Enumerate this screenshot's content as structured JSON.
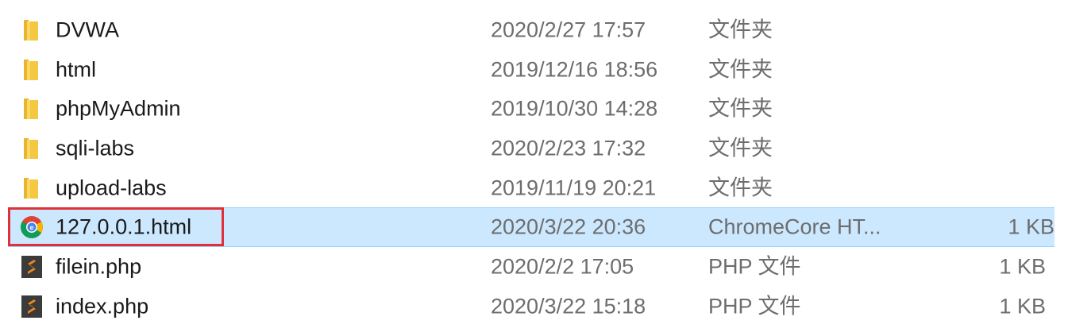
{
  "files": [
    {
      "name": "DVWA",
      "date": "2020/2/27 17:57",
      "type": "文件夹",
      "size": "",
      "icon": "folder-icon"
    },
    {
      "name": "html",
      "date": "2019/12/16 18:56",
      "type": "文件夹",
      "size": "",
      "icon": "folder-icon"
    },
    {
      "name": "phpMyAdmin",
      "date": "2019/10/30 14:28",
      "type": "文件夹",
      "size": "",
      "icon": "folder-icon"
    },
    {
      "name": "sqli-labs",
      "date": "2020/2/23 17:32",
      "type": "文件夹",
      "size": "",
      "icon": "folder-icon"
    },
    {
      "name": "upload-labs",
      "date": "2019/11/19 20:21",
      "type": "文件夹",
      "size": "",
      "icon": "folder-icon"
    },
    {
      "name": "127.0.0.1.html",
      "date": "2020/3/22 20:36",
      "type": "ChromeCore HT...",
      "size": "1 KB",
      "icon": "chrome-html-icon",
      "selected": true
    },
    {
      "name": "filein.php",
      "date": "2020/2/2 17:05",
      "type": "PHP 文件",
      "size": "1 KB",
      "icon": "php-file-icon"
    },
    {
      "name": "index.php",
      "date": "2020/3/22 15:18",
      "type": "PHP 文件",
      "size": "1 KB",
      "icon": "php-file-icon"
    }
  ],
  "colors": {
    "selection_bg": "#cce8ff",
    "selection_border": "#99d1ff",
    "highlight_box": "#e0303a",
    "folder": "#f0c038",
    "php_icon": "#f08a1e"
  }
}
